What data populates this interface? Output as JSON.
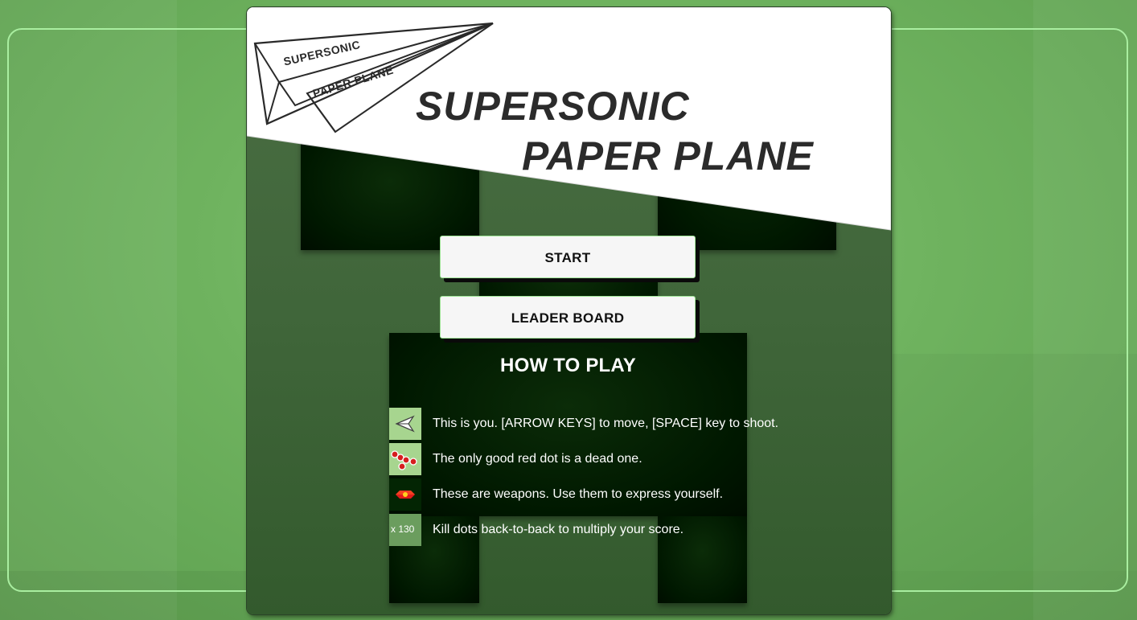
{
  "game": {
    "logo_small_line1": "SUPERSONIC",
    "logo_small_line2": "PAPER PLANE",
    "title_line1": "SUPERSONIC",
    "title_line2": "PAPER PLANE"
  },
  "menu": {
    "start_label": "START",
    "leaderboard_label": "LEADER BOARD"
  },
  "how_to_play": {
    "title": "HOW TO PLAY",
    "rules": [
      {
        "icon": "paper-plane-icon",
        "text": "This is you. [ARROW KEYS] to move, [SPACE] key to shoot."
      },
      {
        "icon": "red-dots-icon",
        "text": "The only good red dot is a dead one."
      },
      {
        "icon": "weapon-icon",
        "text": "These are weapons. Use them to express yourself."
      },
      {
        "icon": "multiplier-icon",
        "text": "Kill dots back-to-back to multiply your score.",
        "icon_label": "x 130"
      }
    ]
  },
  "colors": {
    "frame_accent": "#a9eea0",
    "button_bg": "#f6f6f6",
    "enemy_red": "#e31b1b"
  }
}
